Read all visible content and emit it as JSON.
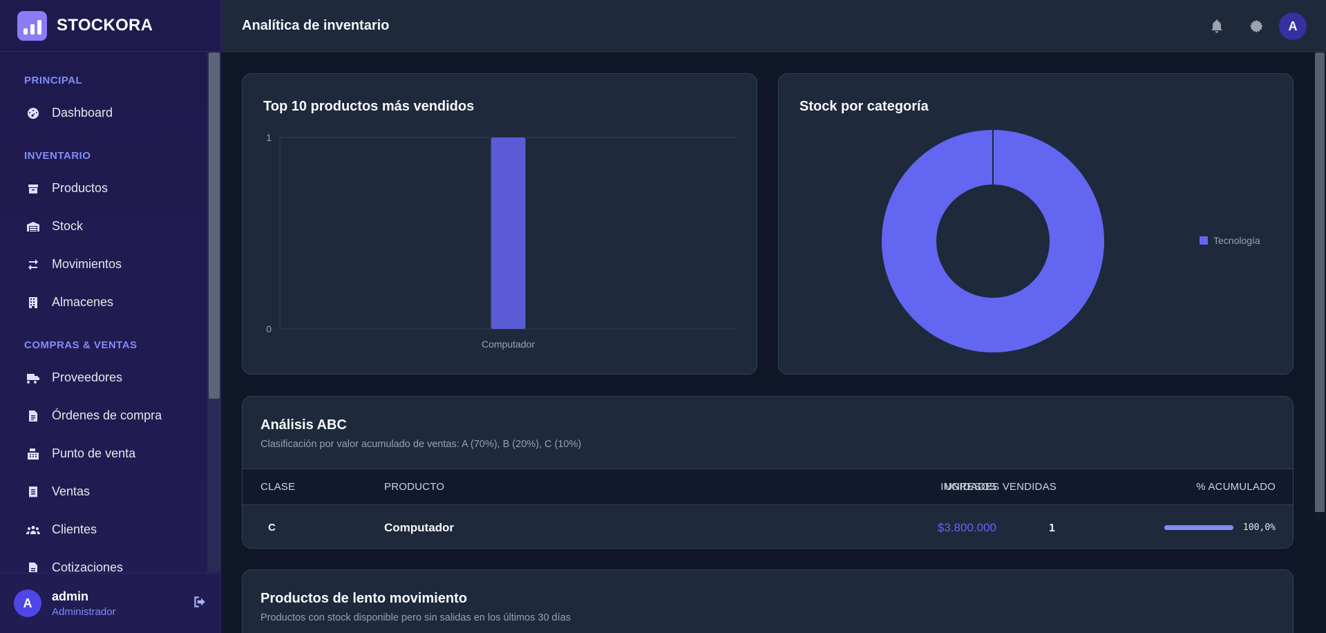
{
  "app": {
    "name": "STOCKORA"
  },
  "sidebar": {
    "sections": [
      {
        "label": "PRINCIPAL",
        "items": [
          {
            "label": "Dashboard",
            "icon": "gauge-icon"
          }
        ]
      },
      {
        "label": "INVENTARIO",
        "items": [
          {
            "label": "Productos",
            "icon": "box-icon"
          },
          {
            "label": "Stock",
            "icon": "warehouse-icon"
          },
          {
            "label": "Movimientos",
            "icon": "arrows-exchange-icon"
          },
          {
            "label": "Almacenes",
            "icon": "building-icon"
          }
        ]
      },
      {
        "label": "COMPRAS & VENTAS",
        "items": [
          {
            "label": "Proveedores",
            "icon": "truck-icon"
          },
          {
            "label": "Órdenes de compra",
            "icon": "file-invoice-icon"
          },
          {
            "label": "Punto de venta",
            "icon": "cash-register-icon"
          },
          {
            "label": "Ventas",
            "icon": "receipt-icon"
          },
          {
            "label": "Clientes",
            "icon": "users-icon"
          },
          {
            "label": "Cotizaciones",
            "icon": "file-icon"
          }
        ]
      }
    ],
    "user": {
      "initial": "A",
      "name": "admin",
      "role": "Administrador"
    }
  },
  "header": {
    "title": "Analítica de inventario",
    "avatar_initial": "A"
  },
  "top_products": {
    "title": "Top 10 productos más vendidos"
  },
  "stock_category": {
    "title": "Stock por categoría"
  },
  "chart_data": [
    {
      "type": "bar",
      "title": "Top 10 productos más vendidos",
      "categories": [
        "Computador"
      ],
      "values": [
        1
      ],
      "ylim": [
        0,
        1
      ],
      "yticks": [
        "0",
        "1"
      ],
      "color": "#5b5bd6",
      "grid": true
    },
    {
      "type": "pie",
      "title": "Stock por categoría",
      "labels": [
        "Tecnología"
      ],
      "values": [
        100
      ],
      "donut": true,
      "color": "#6366f1",
      "legend": "right"
    }
  ],
  "abc": {
    "title": "Análisis ABC",
    "subtitle": "Clasificación por valor acumulado de ventas: A (70%), B (20%), C (10%)",
    "columns": {
      "clase": "CLASE",
      "producto": "PRODUCTO",
      "unidades": "UNIDADES VENDIDAS",
      "ingresos": "INGRESOS",
      "acumulado": "% ACUMULADO"
    },
    "rows": [
      {
        "clase": "C",
        "producto": "Computador",
        "unidades": "1",
        "ingresos": "$3.800.000",
        "acumulado": "100,0%",
        "acumulado_fraction": 1.0
      }
    ]
  },
  "slow": {
    "title": "Productos de lento movimiento",
    "subtitle": "Productos con stock disponible pero sin salidas en los últimos 30 días"
  },
  "colors": {
    "accent": "#818cf8",
    "bar": "#5b5bd6",
    "donut": "#6366f1",
    "revenue": "#6366f1"
  }
}
